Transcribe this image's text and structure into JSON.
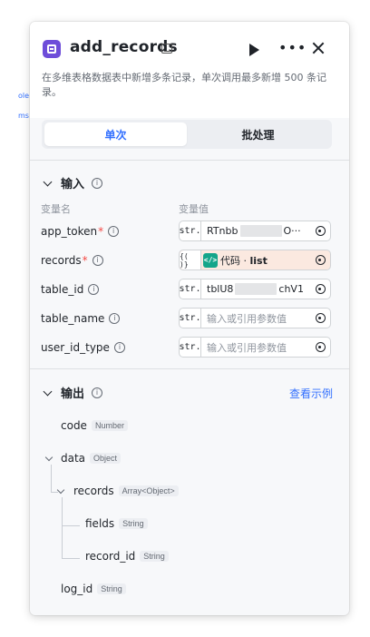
{
  "node": {
    "title": "add_records",
    "description": "在多维表格数据表中新增多条记录，单次调用最多新增 500 条记录。"
  },
  "tabs": [
    {
      "label": "单次",
      "active": true
    },
    {
      "label": "批处理",
      "active": false
    }
  ],
  "input": {
    "section_title": "输入",
    "col_name": "变量名",
    "col_value": "变量值",
    "params": [
      {
        "name": "app_token",
        "required": true,
        "type": "str.",
        "value_prefix": "RTnbb",
        "value_suffix": "O···",
        "placeholder": ""
      },
      {
        "name": "records",
        "required": true,
        "type": "{( )}",
        "ref_source": "代码",
        "ref_sep": " · ",
        "ref_field": "list"
      },
      {
        "name": "table_id",
        "required": false,
        "type": "str.",
        "value_prefix": "tblU8",
        "value_suffix": "chV1",
        "placeholder": ""
      },
      {
        "name": "table_name",
        "required": false,
        "type": "str.",
        "value_prefix": "",
        "value_suffix": "",
        "placeholder": "输入或引用参数值"
      },
      {
        "name": "user_id_type",
        "required": false,
        "type": "str.",
        "value_prefix": "",
        "value_suffix": "",
        "placeholder": "输入或引用参数值"
      }
    ]
  },
  "output": {
    "section_title": "输出",
    "view_example": "查看示例",
    "tree": {
      "code": {
        "name": "code",
        "type": "Number"
      },
      "data": {
        "name": "data",
        "type": "Object"
      },
      "records": {
        "name": "records",
        "type": "Array<Object>"
      },
      "fields": {
        "name": "fields",
        "type": "String"
      },
      "record_id": {
        "name": "record_id",
        "type": "String"
      },
      "log_id": {
        "name": "log_id",
        "type": "String"
      }
    }
  },
  "edge_fragment": {
    "line1": "ole",
    "line2": "ms"
  },
  "colors": {
    "accent": "#3370ff",
    "node_icon": "#6e4dd9",
    "code_icon": "#14a58a",
    "required": "#f54a45",
    "ref_bg": "#fbe9e0"
  },
  "icons": [
    "node-type-icon",
    "debug-badge-icon",
    "run-icon",
    "more-icon",
    "close-icon",
    "chevron-down-icon",
    "info-icon",
    "variable-target-icon",
    "code-icon"
  ]
}
